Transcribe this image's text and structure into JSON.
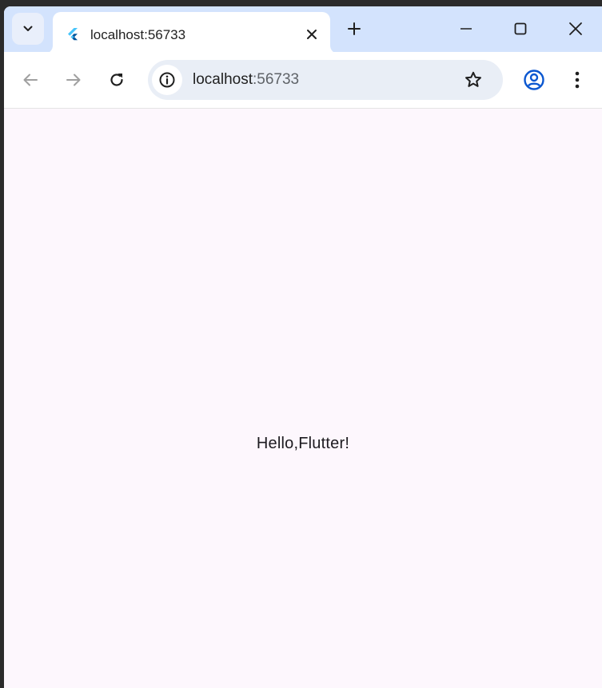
{
  "browser": {
    "tab": {
      "title": "localhost:56733",
      "favicon": "flutter-logo-icon"
    },
    "omnibox": {
      "host": "localhost",
      "port": ":56733"
    },
    "icons": {
      "tab_search": "chevron-down-icon",
      "tab_close": "close-icon",
      "new_tab": "plus-icon",
      "minimize": "minimize-icon",
      "maximize": "maximize-icon",
      "close_window": "close-icon",
      "back": "arrow-left-icon",
      "forward": "arrow-right-icon",
      "reload": "reload-icon",
      "site_info": "info-icon",
      "bookmark": "star-icon",
      "profile": "account-circle-icon",
      "menu": "more-vert-icon"
    },
    "colors": {
      "titlebar": "#d3e3fd",
      "toolbar": "#ffffff",
      "omnibox": "#e9eef6",
      "page_background": "#fdf7fd",
      "icon": "#1f1f1f",
      "icon_disabled": "#a0a0a0",
      "profile_accent": "#0b57d0"
    }
  },
  "page": {
    "text": "Hello,Flutter!"
  }
}
